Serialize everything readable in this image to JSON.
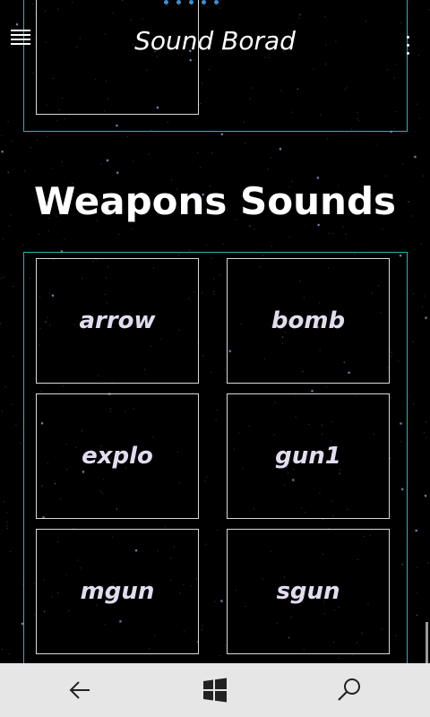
{
  "app": {
    "title": "Sound Borad"
  },
  "section": {
    "title": "Weapons Sounds"
  },
  "sounds": [
    "arrow",
    "bomb",
    "explo",
    "gun1",
    "mgun",
    "sgun"
  ],
  "icons": {
    "menu": "hamburger-icon",
    "more": "more-vertical-icon",
    "back": "back-arrow-icon",
    "home": "windows-logo-icon",
    "search": "search-icon"
  },
  "colors": {
    "background": "#000000",
    "panel_border": "#27b3b8",
    "tile_border": "#d9d9d9",
    "tile_text": "#e3dcef",
    "progress_dots": "#3b8fd6",
    "nav_bar": "#e6e6e6"
  }
}
